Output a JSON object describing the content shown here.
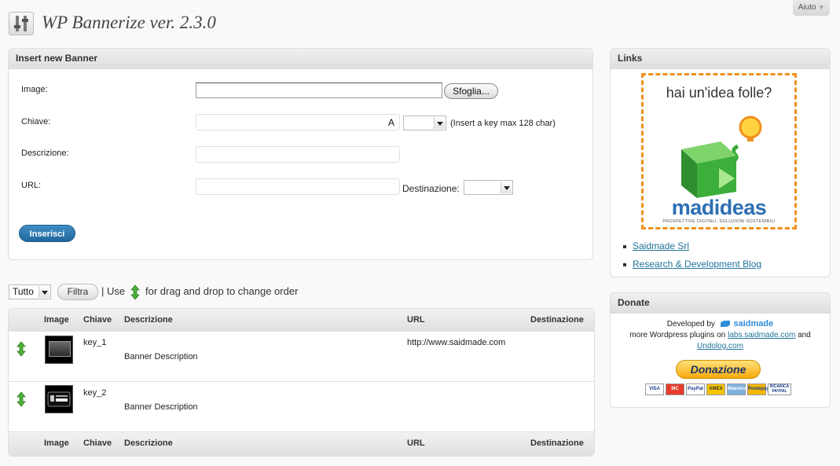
{
  "help_tab": {
    "label": "Aiuto"
  },
  "page": {
    "title": "WP Bannerize ver. 2.3.0"
  },
  "insert_form": {
    "heading": "Insert new Banner",
    "image_label": "Image:",
    "browse_label": "Sfoglia...",
    "key_label": "Chiave:",
    "key_value": "",
    "key_indicator": "A",
    "key_hint": "(Insert a key max 128 char)",
    "key_select_value": "",
    "description_label": "Descrizione:",
    "url_label": "URL:",
    "destination_label": "Destinazione:",
    "destination_value": "",
    "submit_label": "Inserisci"
  },
  "filter_bar": {
    "select_value": "Tutto",
    "filter_button": "Filtra",
    "instruction_prefix": "| Use",
    "instruction_suffix": "for drag and drop to change order"
  },
  "table": {
    "columns": [
      "Image",
      "Chiave",
      "Descrizione",
      "URL",
      "Destinazione"
    ],
    "rows": [
      {
        "key": "key_1",
        "description": "Banner Description",
        "url": "http://www.saidmade.com",
        "destination": "",
        "thumb": "video-thumbnail"
      },
      {
        "key": "key_2",
        "description": "Banner Description",
        "url": "",
        "destination": "",
        "thumb": "app-store-badge"
      }
    ]
  },
  "links_box": {
    "heading": "Links",
    "banner": {
      "tagline": "hai un'idea folle?",
      "brand": "madideas",
      "slogan": "PROSPETTIVE DIGITALI, SOLUZIONI SOSTENIBILI"
    },
    "items": [
      {
        "label": "Saidmade Srl"
      },
      {
        "label": "Research & Development Blog"
      }
    ]
  },
  "donate_box": {
    "heading": "Donate",
    "developed_by": "Developed by",
    "brand": "saidmade",
    "more_plugins": "more Wordpress plugins on",
    "plugins_link": "labs.saidmade.com",
    "and": "and",
    "undolog_link": "Undolog.com",
    "button_label": "Donazione",
    "cards": [
      "VISA",
      "MC",
      "PayPal",
      "AMEX",
      "Maestro",
      "Postepay",
      "RICARICA PAYPAL"
    ]
  },
  "colors": {
    "accent_blue": "#21759b",
    "orange_dash": "#f0901d",
    "green": "#3cae3c"
  }
}
